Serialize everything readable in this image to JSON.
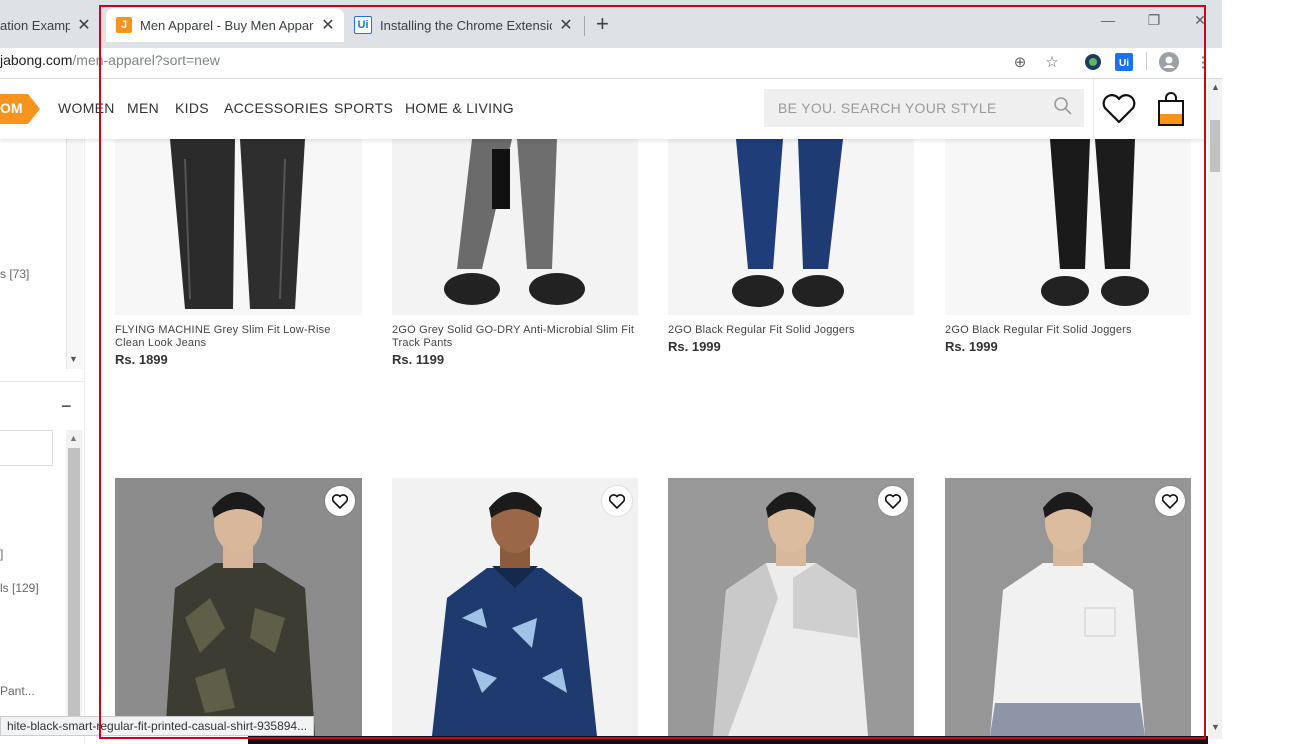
{
  "browser": {
    "tabs": [
      {
        "title": "ation Example",
        "favicon": "",
        "active": false
      },
      {
        "title": "Men Apparel - Buy Men Apparel",
        "favicon": "J",
        "active": true
      },
      {
        "title": "Installing the Chrome Extension",
        "favicon": "Ui",
        "active": false
      }
    ],
    "new_tab_label": "+",
    "url_host": "jabong.com",
    "url_path": "/men-apparel?sort=new",
    "status_url": "hite-black-smart-regular-fit-printed-casual-shirt-935894..."
  },
  "site": {
    "logo_text": "OM",
    "nav": [
      "WOMEN",
      "MEN",
      "KIDS",
      "ACCESSORIES",
      "SPORTS",
      "HOME & LIVING"
    ],
    "search_placeholder": "BE YOU. SEARCH YOUR STYLE"
  },
  "sidebar": {
    "items": [
      "s [73]",
      "ls [129]",
      "Pant..."
    ],
    "minus_label": "−",
    "stray": "]"
  },
  "products_row1": [
    {
      "name": "FLYING MACHINE Grey Slim Fit Low-Rise Clean Look Jeans",
      "price": "Rs. 1899"
    },
    {
      "name": "2GO Grey Solid GO-DRY Anti-Microbial Slim Fit Track Pants",
      "price": "Rs. 1199"
    },
    {
      "name": "2GO Black Regular Fit Solid Joggers",
      "price": "Rs. 1999"
    },
    {
      "name": "2GO Black Regular Fit Solid Joggers",
      "price": "Rs. 1999"
    }
  ],
  "colors": {
    "brand_orange": "#f7941d",
    "selection_frame": "#d0021b"
  }
}
